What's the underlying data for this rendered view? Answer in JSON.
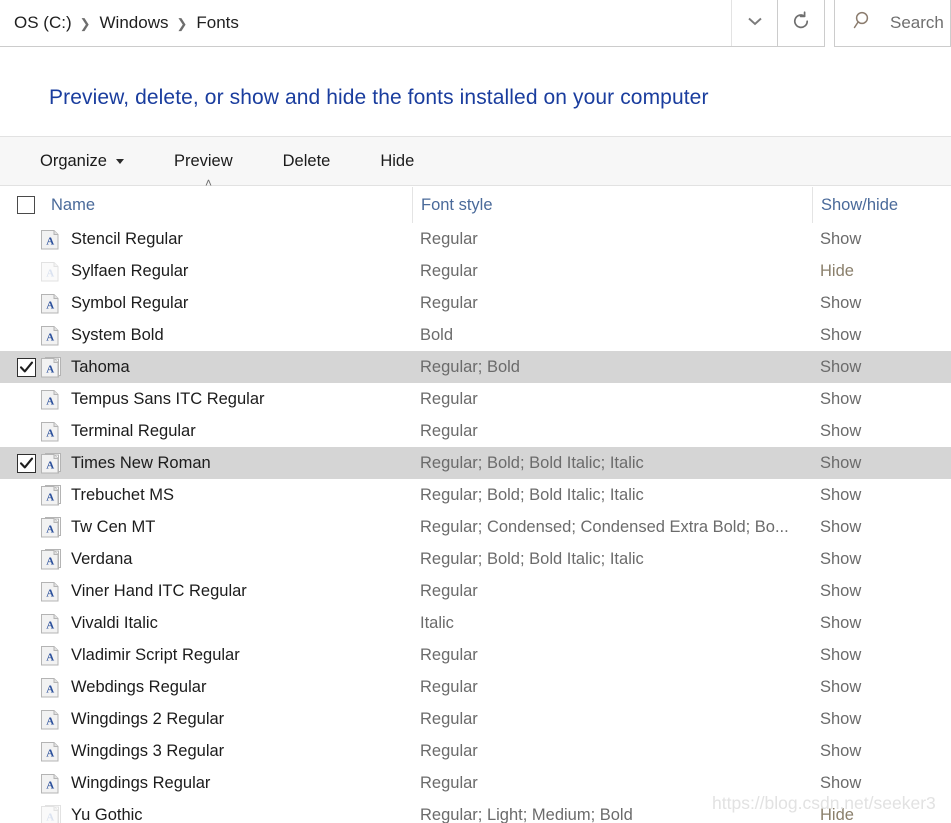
{
  "address": {
    "breadcrumbs": [
      "OS (C:)",
      "Windows",
      "Fonts"
    ],
    "separator": "❯",
    "caret_icon": "chevron-down-icon",
    "refresh_icon": "refresh-icon",
    "search_icon": "search-icon",
    "search_placeholder": "Search",
    "search_value": ""
  },
  "page": {
    "title": "Preview, delete, or show and hide the fonts installed on your computer",
    "title_color": "#1a3d9e"
  },
  "toolbar": {
    "organize_label": "Organize",
    "preview_label": "Preview",
    "delete_label": "Delete",
    "hide_label": "Hide"
  },
  "columns": {
    "name": "Name",
    "font_style": "Font style",
    "show_hide": "Show/hide",
    "sort_indicator": "˄"
  },
  "rows": [
    {
      "name": "Stencil Regular",
      "style": "Regular",
      "show": "Show",
      "selected": false,
      "dimmed": false,
      "multi": false
    },
    {
      "name": "Sylfaen Regular",
      "style": "Regular",
      "show": "Hide",
      "selected": false,
      "dimmed": true,
      "multi": false
    },
    {
      "name": "Symbol Regular",
      "style": "Regular",
      "show": "Show",
      "selected": false,
      "dimmed": false,
      "multi": false
    },
    {
      "name": "System Bold",
      "style": "Bold",
      "show": "Show",
      "selected": false,
      "dimmed": false,
      "multi": false
    },
    {
      "name": "Tahoma",
      "style": "Regular; Bold",
      "show": "Show",
      "selected": true,
      "dimmed": false,
      "multi": true
    },
    {
      "name": "Tempus Sans ITC Regular",
      "style": "Regular",
      "show": "Show",
      "selected": false,
      "dimmed": false,
      "multi": false
    },
    {
      "name": "Terminal Regular",
      "style": "Regular",
      "show": "Show",
      "selected": false,
      "dimmed": false,
      "multi": false
    },
    {
      "name": "Times New Roman",
      "style": "Regular; Bold; Bold Italic; Italic",
      "show": "Show",
      "selected": true,
      "dimmed": false,
      "multi": true
    },
    {
      "name": "Trebuchet MS",
      "style": "Regular; Bold; Bold Italic; Italic",
      "show": "Show",
      "selected": false,
      "dimmed": false,
      "multi": true
    },
    {
      "name": "Tw Cen MT",
      "style": "Regular; Condensed; Condensed Extra Bold; Bo...",
      "show": "Show",
      "selected": false,
      "dimmed": false,
      "multi": true
    },
    {
      "name": "Verdana",
      "style": "Regular; Bold; Bold Italic; Italic",
      "show": "Show",
      "selected": false,
      "dimmed": false,
      "multi": true
    },
    {
      "name": "Viner Hand ITC Regular",
      "style": "Regular",
      "show": "Show",
      "selected": false,
      "dimmed": false,
      "multi": false
    },
    {
      "name": "Vivaldi Italic",
      "style": "Italic",
      "show": "Show",
      "selected": false,
      "dimmed": false,
      "multi": false
    },
    {
      "name": "Vladimir Script Regular",
      "style": "Regular",
      "show": "Show",
      "selected": false,
      "dimmed": false,
      "multi": false
    },
    {
      "name": "Webdings Regular",
      "style": "Regular",
      "show": "Show",
      "selected": false,
      "dimmed": false,
      "multi": false
    },
    {
      "name": "Wingdings 2 Regular",
      "style": "Regular",
      "show": "Show",
      "selected": false,
      "dimmed": false,
      "multi": false
    },
    {
      "name": "Wingdings 3 Regular",
      "style": "Regular",
      "show": "Show",
      "selected": false,
      "dimmed": false,
      "multi": false
    },
    {
      "name": "Wingdings Regular",
      "style": "Regular",
      "show": "Show",
      "selected": false,
      "dimmed": false,
      "multi": false
    },
    {
      "name": "Yu Gothic",
      "style": "Regular; Light; Medium; Bold",
      "show": "Hide",
      "selected": false,
      "dimmed": true,
      "multi": true
    }
  ],
  "watermark": {
    "text": "https://blog.csdn.net/seeker3"
  }
}
